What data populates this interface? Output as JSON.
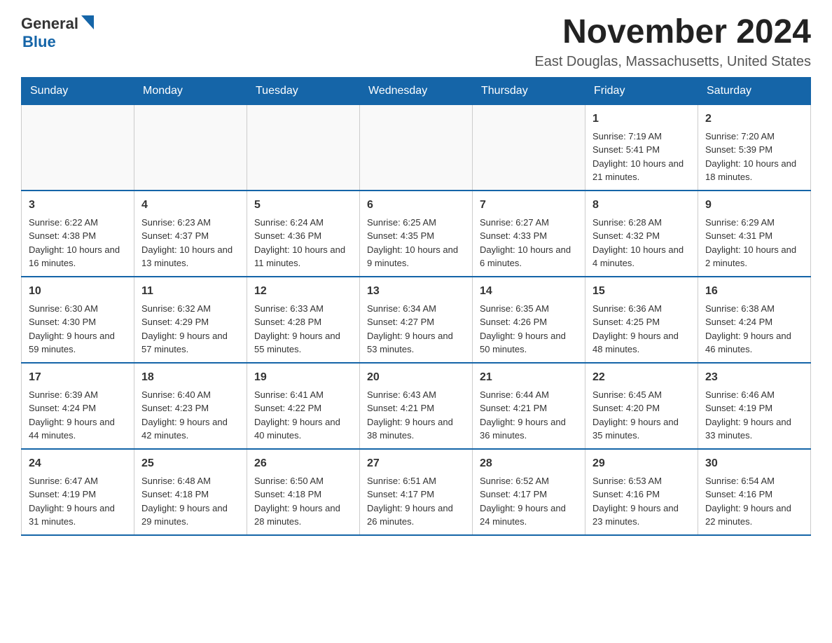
{
  "logo": {
    "general": "General",
    "blue": "Blue"
  },
  "header": {
    "month_year": "November 2024",
    "location": "East Douglas, Massachusetts, United States"
  },
  "weekdays": [
    "Sunday",
    "Monday",
    "Tuesday",
    "Wednesday",
    "Thursday",
    "Friday",
    "Saturday"
  ],
  "weeks": [
    [
      {
        "day": "",
        "info": ""
      },
      {
        "day": "",
        "info": ""
      },
      {
        "day": "",
        "info": ""
      },
      {
        "day": "",
        "info": ""
      },
      {
        "day": "",
        "info": ""
      },
      {
        "day": "1",
        "info": "Sunrise: 7:19 AM\nSunset: 5:41 PM\nDaylight: 10 hours and 21 minutes."
      },
      {
        "day": "2",
        "info": "Sunrise: 7:20 AM\nSunset: 5:39 PM\nDaylight: 10 hours and 18 minutes."
      }
    ],
    [
      {
        "day": "3",
        "info": "Sunrise: 6:22 AM\nSunset: 4:38 PM\nDaylight: 10 hours and 16 minutes."
      },
      {
        "day": "4",
        "info": "Sunrise: 6:23 AM\nSunset: 4:37 PM\nDaylight: 10 hours and 13 minutes."
      },
      {
        "day": "5",
        "info": "Sunrise: 6:24 AM\nSunset: 4:36 PM\nDaylight: 10 hours and 11 minutes."
      },
      {
        "day": "6",
        "info": "Sunrise: 6:25 AM\nSunset: 4:35 PM\nDaylight: 10 hours and 9 minutes."
      },
      {
        "day": "7",
        "info": "Sunrise: 6:27 AM\nSunset: 4:33 PM\nDaylight: 10 hours and 6 minutes."
      },
      {
        "day": "8",
        "info": "Sunrise: 6:28 AM\nSunset: 4:32 PM\nDaylight: 10 hours and 4 minutes."
      },
      {
        "day": "9",
        "info": "Sunrise: 6:29 AM\nSunset: 4:31 PM\nDaylight: 10 hours and 2 minutes."
      }
    ],
    [
      {
        "day": "10",
        "info": "Sunrise: 6:30 AM\nSunset: 4:30 PM\nDaylight: 9 hours and 59 minutes."
      },
      {
        "day": "11",
        "info": "Sunrise: 6:32 AM\nSunset: 4:29 PM\nDaylight: 9 hours and 57 minutes."
      },
      {
        "day": "12",
        "info": "Sunrise: 6:33 AM\nSunset: 4:28 PM\nDaylight: 9 hours and 55 minutes."
      },
      {
        "day": "13",
        "info": "Sunrise: 6:34 AM\nSunset: 4:27 PM\nDaylight: 9 hours and 53 minutes."
      },
      {
        "day": "14",
        "info": "Sunrise: 6:35 AM\nSunset: 4:26 PM\nDaylight: 9 hours and 50 minutes."
      },
      {
        "day": "15",
        "info": "Sunrise: 6:36 AM\nSunset: 4:25 PM\nDaylight: 9 hours and 48 minutes."
      },
      {
        "day": "16",
        "info": "Sunrise: 6:38 AM\nSunset: 4:24 PM\nDaylight: 9 hours and 46 minutes."
      }
    ],
    [
      {
        "day": "17",
        "info": "Sunrise: 6:39 AM\nSunset: 4:24 PM\nDaylight: 9 hours and 44 minutes."
      },
      {
        "day": "18",
        "info": "Sunrise: 6:40 AM\nSunset: 4:23 PM\nDaylight: 9 hours and 42 minutes."
      },
      {
        "day": "19",
        "info": "Sunrise: 6:41 AM\nSunset: 4:22 PM\nDaylight: 9 hours and 40 minutes."
      },
      {
        "day": "20",
        "info": "Sunrise: 6:43 AM\nSunset: 4:21 PM\nDaylight: 9 hours and 38 minutes."
      },
      {
        "day": "21",
        "info": "Sunrise: 6:44 AM\nSunset: 4:21 PM\nDaylight: 9 hours and 36 minutes."
      },
      {
        "day": "22",
        "info": "Sunrise: 6:45 AM\nSunset: 4:20 PM\nDaylight: 9 hours and 35 minutes."
      },
      {
        "day": "23",
        "info": "Sunrise: 6:46 AM\nSunset: 4:19 PM\nDaylight: 9 hours and 33 minutes."
      }
    ],
    [
      {
        "day": "24",
        "info": "Sunrise: 6:47 AM\nSunset: 4:19 PM\nDaylight: 9 hours and 31 minutes."
      },
      {
        "day": "25",
        "info": "Sunrise: 6:48 AM\nSunset: 4:18 PM\nDaylight: 9 hours and 29 minutes."
      },
      {
        "day": "26",
        "info": "Sunrise: 6:50 AM\nSunset: 4:18 PM\nDaylight: 9 hours and 28 minutes."
      },
      {
        "day": "27",
        "info": "Sunrise: 6:51 AM\nSunset: 4:17 PM\nDaylight: 9 hours and 26 minutes."
      },
      {
        "day": "28",
        "info": "Sunrise: 6:52 AM\nSunset: 4:17 PM\nDaylight: 9 hours and 24 minutes."
      },
      {
        "day": "29",
        "info": "Sunrise: 6:53 AM\nSunset: 4:16 PM\nDaylight: 9 hours and 23 minutes."
      },
      {
        "day": "30",
        "info": "Sunrise: 6:54 AM\nSunset: 4:16 PM\nDaylight: 9 hours and 22 minutes."
      }
    ]
  ]
}
